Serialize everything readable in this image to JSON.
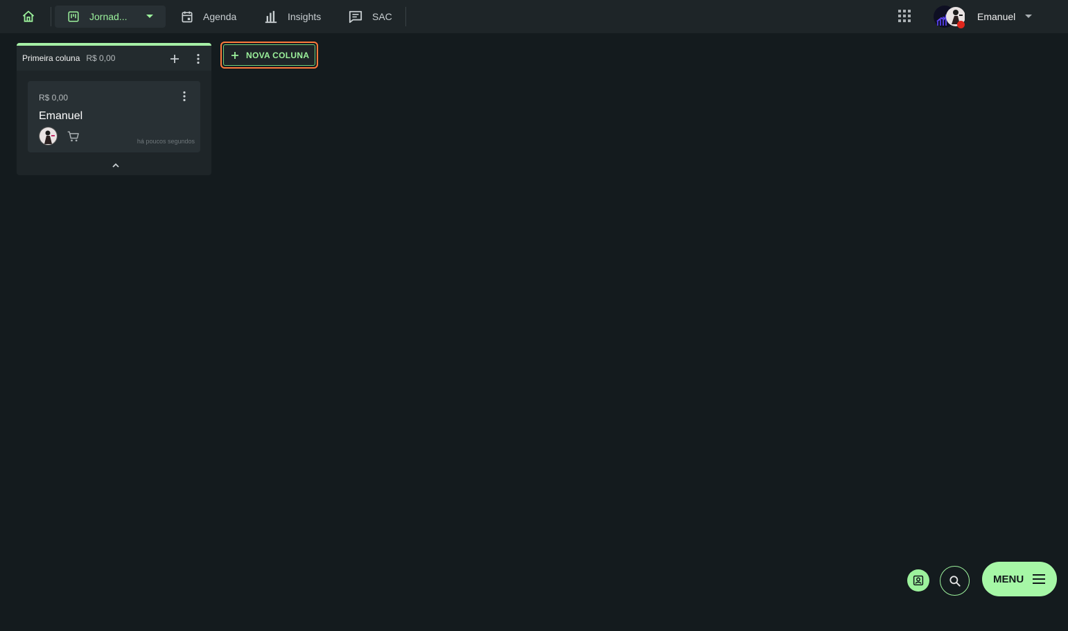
{
  "topbar": {
    "board_name": "Jornad...",
    "nav": [
      {
        "label": "Agenda",
        "icon": "calendar-icon"
      },
      {
        "label": "Insights",
        "icon": "bar-chart-icon"
      },
      {
        "label": "SAC",
        "icon": "chat-icon"
      }
    ],
    "user_name": "Emanuel"
  },
  "board": {
    "columns": [
      {
        "title": "Primeira coluna",
        "total": "R$ 0,00",
        "cards": [
          {
            "value": "R$ 0,00",
            "title": "Emanuel",
            "time": "há poucos segundos"
          }
        ]
      }
    ],
    "new_column_label": "NOVA COLUNA"
  },
  "fab": {
    "menu_label": "MENU"
  },
  "colors": {
    "accent": "#9cf29c",
    "background": "#141b1e",
    "surface": "#1e2528",
    "focus_ring": "#ff7a3c",
    "status_offline": "#e0261c"
  }
}
